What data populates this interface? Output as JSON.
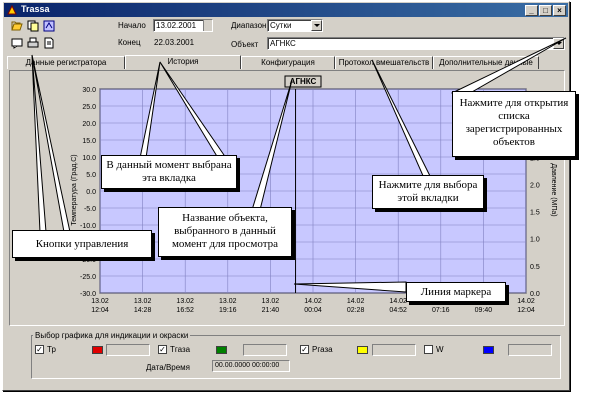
{
  "window": {
    "title": "Trassa",
    "controls": [
      "_",
      "□",
      "×"
    ]
  },
  "toolbar": {
    "icons": [
      "open-icon",
      "copy-icon",
      "config-icon",
      "note-icon",
      "print-icon",
      "doc-icon"
    ],
    "start_label": "Начало",
    "start_value": "13.02.2001",
    "end_label": "Конец",
    "end_value": "22.03.2001",
    "range_label": "Диапазон",
    "range_value": "Сутки",
    "object_label": "Объект",
    "object_value": "АГНКС"
  },
  "tabs": [
    {
      "label": "Данные регистратора",
      "active": false
    },
    {
      "label": "История",
      "active": true
    },
    {
      "label": "Конфигурация",
      "active": false
    },
    {
      "label": "Протокол вмешательств",
      "active": false
    },
    {
      "label": "Дополнительные данные",
      "active": false
    }
  ],
  "chart_data": {
    "type": "line",
    "title": "АГНКС",
    "ylabel": "Температура (Град.С)",
    "y2label": "Давление (МПа)",
    "ylim": [
      -30,
      30
    ],
    "y2lim": [
      0,
      3.5
    ],
    "yticks": [
      "30.0",
      "25.0",
      "20.0",
      "15.0",
      "10.0",
      "5.0",
      "0.0",
      "-5.0",
      "-10.0",
      "-15.0",
      "-20.0",
      "-25.0",
      "-30.0"
    ],
    "y2ticks": [
      "3.5",
      "3.0",
      "2.5",
      "2.0",
      "1.5",
      "1.0",
      "0.5",
      "0.0"
    ],
    "xticks": [
      {
        "date": "13.02",
        "time": "12:04"
      },
      {
        "date": "13.02",
        "time": "14:28"
      },
      {
        "date": "13.02",
        "time": "16:52"
      },
      {
        "date": "13.02",
        "time": "19:16"
      },
      {
        "date": "13.02",
        "time": "21:40"
      },
      {
        "date": "14.02",
        "time": "00:04"
      },
      {
        "date": "14.02",
        "time": "02:28"
      },
      {
        "date": "14.02",
        "time": "04:52"
      },
      {
        "date": "14.02",
        "time": "07:16"
      },
      {
        "date": "14.02",
        "time": "09:40"
      },
      {
        "date": "14.02",
        "time": "12:04"
      }
    ],
    "marker_x": "13.02 23:05",
    "grid": true,
    "series": []
  },
  "selection": {
    "title": "Выбор графика для индикации и окраски",
    "items": [
      {
        "label": "Тр",
        "checked": true,
        "color": "#e00000"
      },
      {
        "label": "Тгаза",
        "checked": true,
        "color": "#008000"
      },
      {
        "label": "Ргаза",
        "checked": true,
        "color": "#ffff00"
      },
      {
        "label": "W",
        "checked": false,
        "color": "#0000ff"
      }
    ],
    "datetime_label": "Дата/Время",
    "datetime_value": "00.00.0000 00:00:00"
  },
  "callouts": {
    "open_list": "Нажмите для открытия списка зарегистрированных объектов",
    "selected_tab": "В данный момент выбрана эта вкладка",
    "choose_tab": "Нажмите для выбора этой вкладки",
    "object_name": "Название объекта, выбранного в данный момент для просмотра",
    "controls": "Кнопки управления",
    "marker_line": "Линия маркера"
  }
}
